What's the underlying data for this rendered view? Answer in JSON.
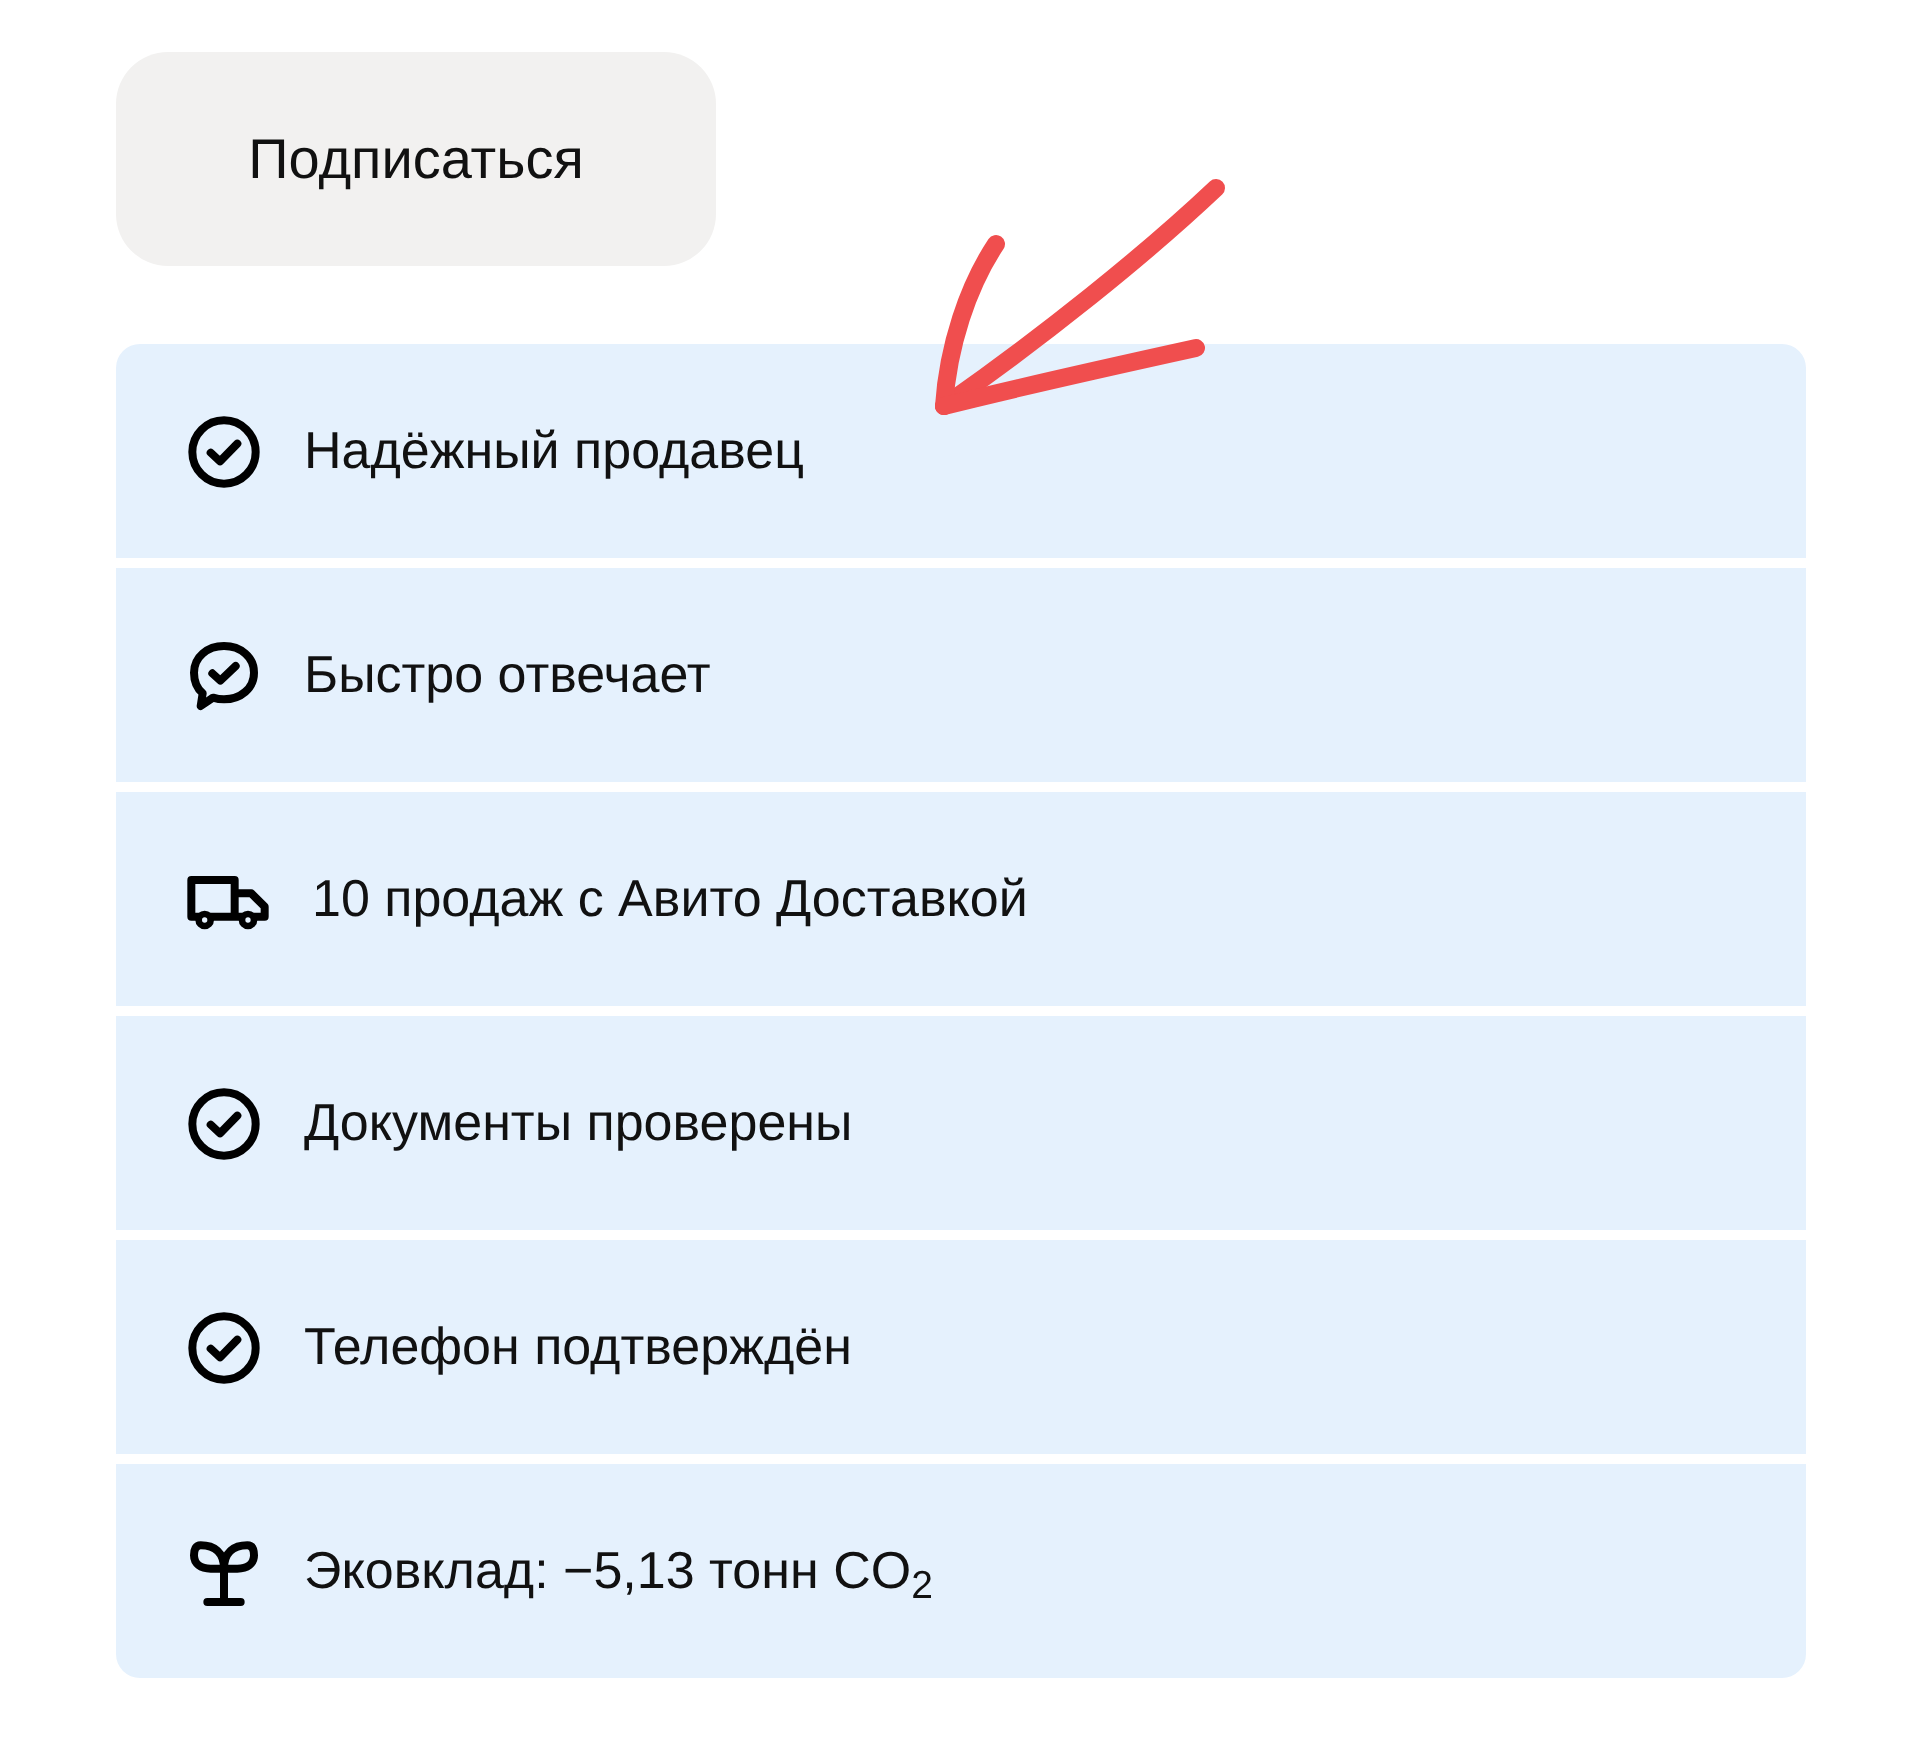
{
  "subscribe_button": {
    "label": "Подписаться"
  },
  "badges": [
    {
      "kind": "check",
      "text": "Надёжный продавец"
    },
    {
      "kind": "chat",
      "text": "Быстро отвечает"
    },
    {
      "kind": "truck",
      "text": "10 продаж с Авито Доставкой"
    },
    {
      "kind": "check",
      "text": "Документы проверены"
    },
    {
      "kind": "check",
      "text": "Телефон подтверждён"
    },
    {
      "kind": "sprout",
      "text": "Эковклад: −5,13 тонн CO$_{2}$"
    }
  ]
}
